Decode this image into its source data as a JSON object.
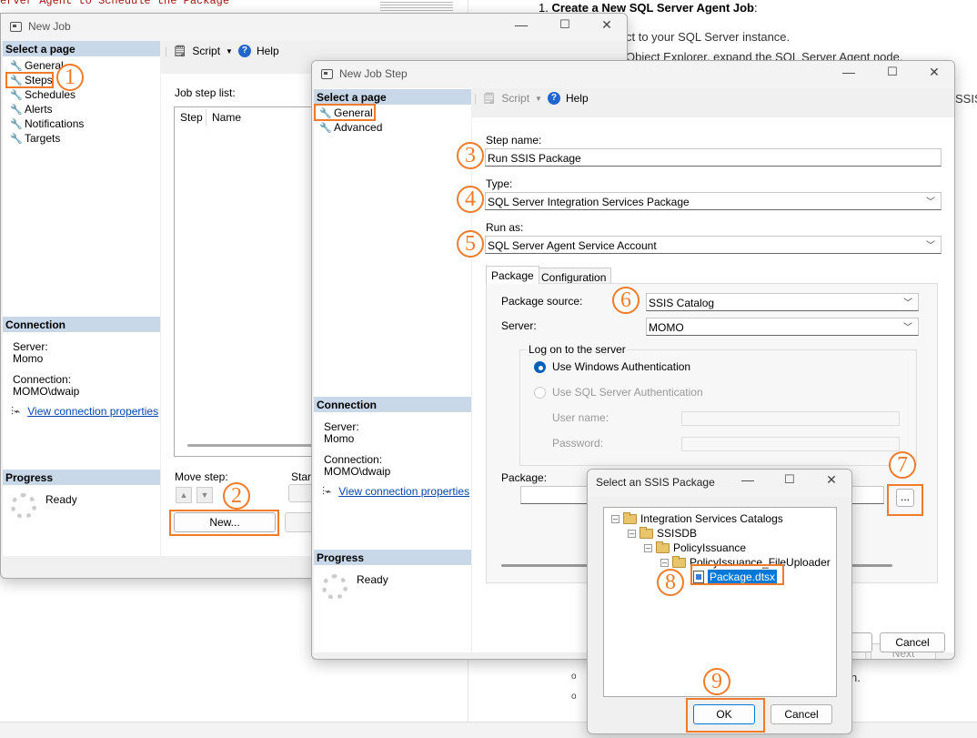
{
  "background": {
    "code_line": "erver Agent to Schedule the Package",
    "step1_num": "1. ",
    "step1_title": "Create a New SQL Server Agent Job",
    "step1_colon": ":",
    "frag1": "ct to your SQL Server instance.",
    "frag2": "Object Explorer, expand the SQL Server Agent node.",
    "frag3": "SSIS",
    "frag4": "n.",
    "bullet": "o"
  },
  "new_job": {
    "title": "New Job",
    "select_page": "Select a page",
    "pages": [
      "General",
      "Steps",
      "Schedules",
      "Alerts",
      "Notifications",
      "Targets"
    ],
    "toolbar": {
      "script": "Script",
      "help": "Help"
    },
    "job_step_list": "Job step list:",
    "grid_headers": [
      "Step",
      "Name"
    ],
    "connection_header": "Connection",
    "server_label": "Server:",
    "server_value": "Momo",
    "connection_label": "Connection:",
    "connection_value": "MOMO\\dwaip",
    "view_conn": "View connection properties",
    "progress_header": "Progress",
    "ready": "Ready",
    "move_step": "Move step:",
    "start": "Start",
    "new_button": "New..."
  },
  "new_job_step": {
    "title": "New Job Step",
    "select_page": "Select a page",
    "pages": [
      "General",
      "Advanced"
    ],
    "toolbar": {
      "script": "Script",
      "help": "Help"
    },
    "step_name_label": "Step name:",
    "step_name_value": "Run SSIS Package",
    "type_label": "Type:",
    "type_value": "SQL Server Integration Services Package",
    "runas_label": "Run as:",
    "runas_value": "SQL Server Agent Service Account",
    "tabs": [
      "Package",
      "Configuration"
    ],
    "package_source_label": "Package source:",
    "package_source_value": "SSIS Catalog",
    "server_label": "Server:",
    "server_value": "MOMO",
    "logon_group": "Log on to the server",
    "auth_windows": "Use Windows Authentication",
    "auth_sql": "Use SQL Server Authentication",
    "username_label": "User name:",
    "password_label": "Password:",
    "package_label": "Package:",
    "browse_button": "...",
    "connection_header": "Connection",
    "server_label2": "Server:",
    "server_value2": "Momo",
    "connection_label": "Connection:",
    "connection_value": "MOMO\\dwaip",
    "view_conn": "View connection properties",
    "progress_header": "Progress",
    "ready": "Ready",
    "next_button": "Next",
    "cancel_button": "Cancel"
  },
  "select_pkg": {
    "title": "Select an SSIS Package",
    "tree": [
      "Integration Services Catalogs",
      "SSISDB",
      "PolicyIssuance",
      "PolicyIssuance_FileUploader",
      "Package.dtsx"
    ],
    "ok_button": "OK",
    "cancel_button": "Cancel"
  },
  "annotations": [
    "1",
    "2",
    "3",
    "4",
    "5",
    "6",
    "7",
    "8",
    "9"
  ],
  "window_controls": {
    "minimize": "—",
    "maximize": "☐",
    "close": "✕"
  },
  "colors": {
    "accent": "#f07c2b",
    "section_header": "#c8d8e8",
    "link": "#0645ad",
    "selected": "#0078d7"
  }
}
